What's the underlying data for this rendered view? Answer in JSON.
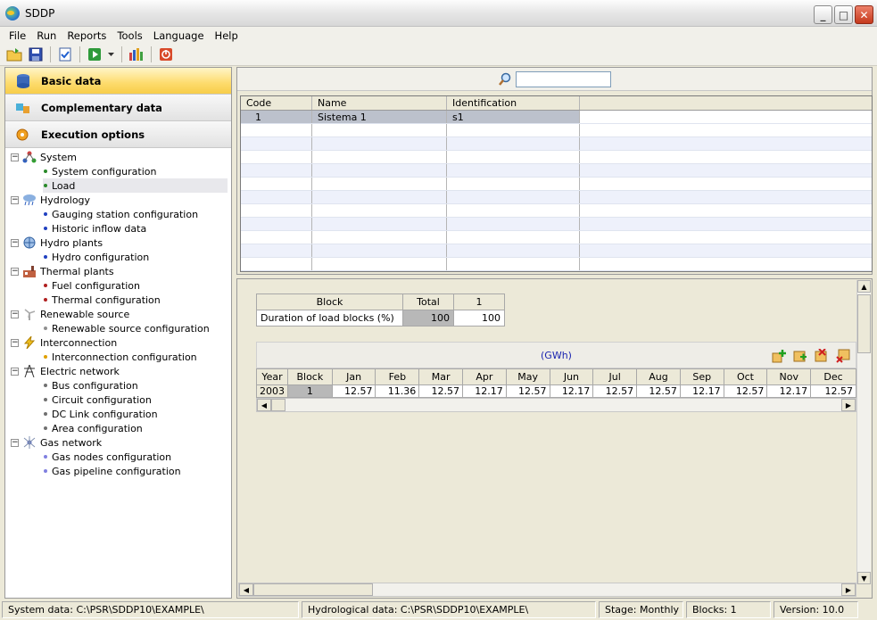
{
  "window": {
    "title": "SDDP"
  },
  "menu": [
    "File",
    "Run",
    "Reports",
    "Tools",
    "Language",
    "Help"
  ],
  "toolbar": {
    "icons": [
      "open-folder-icon",
      "save-icon",
      "checklist-icon",
      "run-icon",
      "run-dropdown-icon",
      "reports-icon",
      "stop-icon"
    ]
  },
  "categories": [
    {
      "label": "Basic data",
      "icon": "database-icon",
      "active": true
    },
    {
      "label": "Complementary data",
      "icon": "puzzle-icon",
      "active": false
    },
    {
      "label": "Execution options",
      "icon": "gears-icon",
      "active": false
    }
  ],
  "tree": [
    {
      "label": "System",
      "icon": "system-icon",
      "children": [
        {
          "label": "System configuration",
          "dot": "#2a8a2a"
        },
        {
          "label": "Load",
          "dot": "#2a8a2a",
          "selected": true
        }
      ]
    },
    {
      "label": "Hydrology",
      "icon": "rain-cloud-icon",
      "children": [
        {
          "label": "Gauging station configuration",
          "dot": "#2040c0"
        },
        {
          "label": "Historic inflow data",
          "dot": "#2040c0"
        }
      ]
    },
    {
      "label": "Hydro plants",
      "icon": "hydro-plant-icon",
      "children": [
        {
          "label": "Hydro configuration",
          "dot": "#2040c0"
        }
      ]
    },
    {
      "label": "Thermal plants",
      "icon": "thermal-plant-icon",
      "children": [
        {
          "label": "Fuel configuration",
          "dot": "#b02020"
        },
        {
          "label": "Thermal configuration",
          "dot": "#b02020"
        }
      ]
    },
    {
      "label": "Renewable source",
      "icon": "wind-turbine-icon",
      "children": [
        {
          "label": "Renewable source configuration",
          "dot": "#909090"
        }
      ]
    },
    {
      "label": "Interconnection",
      "icon": "lightning-icon",
      "children": [
        {
          "label": "Interconnection configuration",
          "dot": "#e0a000"
        }
      ]
    },
    {
      "label": "Electric network",
      "icon": "transmission-tower-icon",
      "children": [
        {
          "label": "Bus configuration",
          "dot": "#707070"
        },
        {
          "label": "Circuit configuration",
          "dot": "#707070"
        },
        {
          "label": "DC Link configuration",
          "dot": "#707070"
        },
        {
          "label": "Area configuration",
          "dot": "#707070"
        }
      ]
    },
    {
      "label": "Gas network",
      "icon": "gas-network-icon",
      "children": [
        {
          "label": "Gas nodes configuration",
          "dot": "#8080e0"
        },
        {
          "label": "Gas pipeline configuration",
          "dot": "#8080e0"
        }
      ]
    }
  ],
  "search": {
    "value": "",
    "placeholder": ""
  },
  "systems_table": {
    "columns": [
      "Code",
      "Name",
      "Identification"
    ],
    "rows": [
      [
        "1",
        "Sistema 1",
        "s1"
      ]
    ]
  },
  "blocks_table": {
    "headers": [
      "Block",
      "Total",
      "1"
    ],
    "row_label": "Duration of load blocks (%)",
    "total": "100",
    "values": [
      "100"
    ]
  },
  "load_table": {
    "unit": "(GWh)",
    "columns": [
      "Year",
      "Block",
      "Jan",
      "Feb",
      "Mar",
      "Apr",
      "May",
      "Jun",
      "Jul",
      "Aug",
      "Sep",
      "Oct",
      "Nov",
      "Dec"
    ],
    "rows": [
      [
        "2003",
        "1",
        "12.57",
        "11.36",
        "12.57",
        "12.17",
        "12.57",
        "12.17",
        "12.57",
        "12.57",
        "12.17",
        "12.57",
        "12.17",
        "12.57"
      ]
    ],
    "icons": [
      "add-row-icon",
      "insert-row-icon",
      "delete-row-icon",
      "clear-icon"
    ]
  },
  "status": {
    "system_data": "System data: C:\\PSR\\SDDP10\\EXAMPLE\\",
    "hydro_data": "Hydrological data: C:\\PSR\\SDDP10\\EXAMPLE\\",
    "stage": "Stage: Monthly",
    "blocks": "Blocks: 1",
    "version": "Version: 10.0"
  }
}
